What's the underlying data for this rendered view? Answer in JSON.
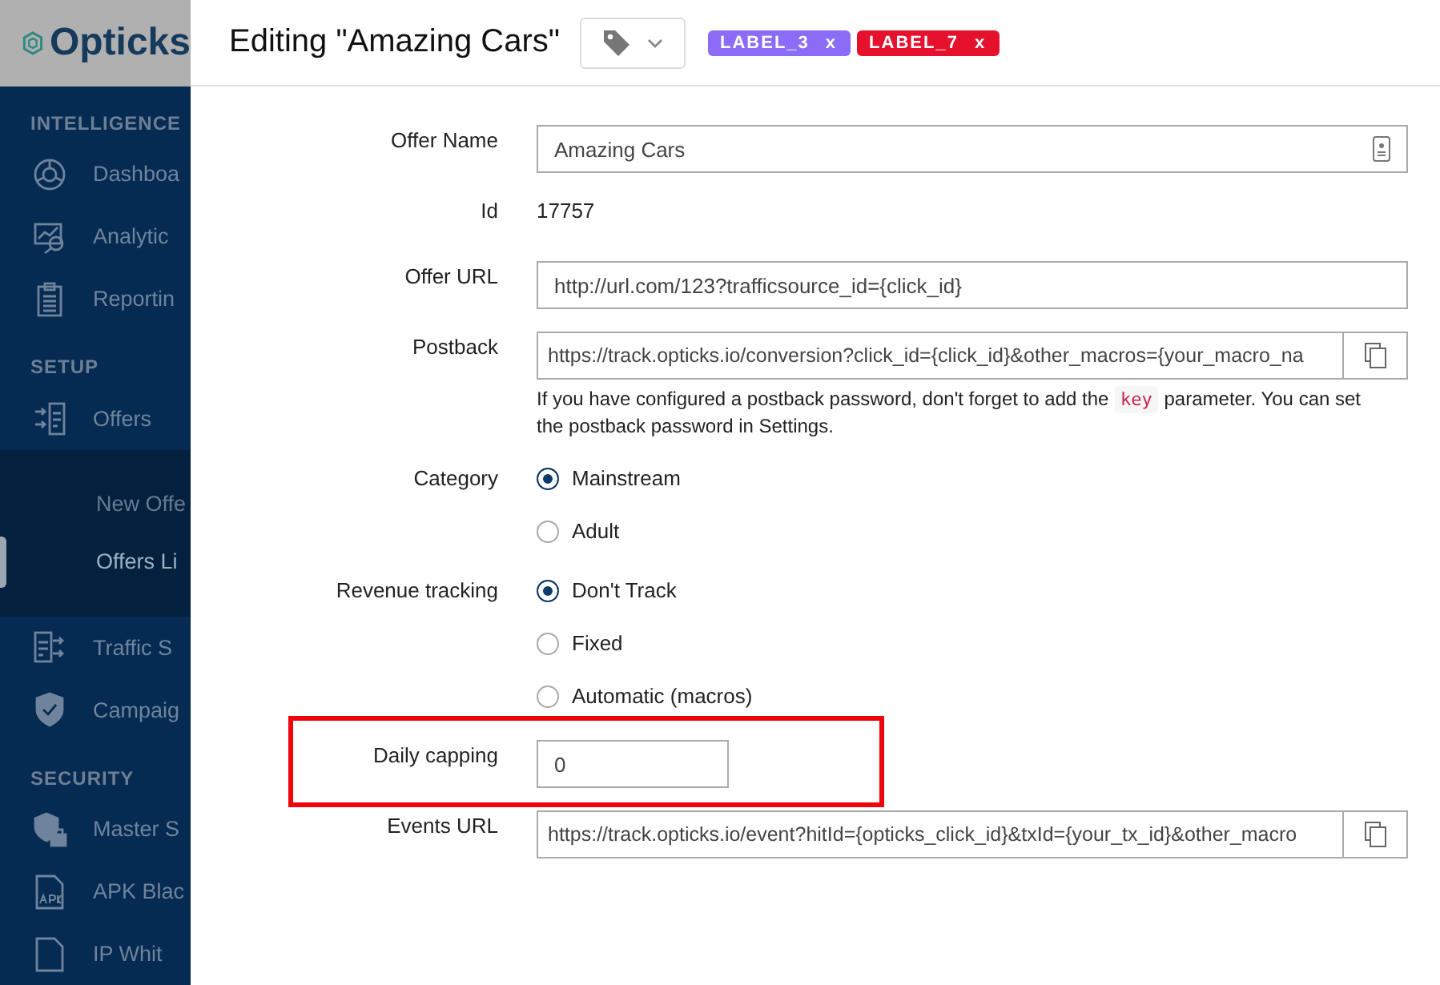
{
  "sidebar": {
    "logo": "Opticks",
    "sections": [
      {
        "heading": "INTELLIGENCE",
        "items": [
          {
            "label": "Dashboa",
            "expanded": false
          },
          {
            "label": "Analytic",
            "expanded": false
          },
          {
            "label": "Reportin",
            "expanded": false
          }
        ]
      },
      {
        "heading": "SETUP",
        "items": [
          {
            "label": "Offers",
            "expanded": true,
            "children": [
              {
                "label": "New Offe",
                "selected": false
              },
              {
                "label": "Offers Li",
                "selected": true
              }
            ]
          },
          {
            "label": "Traffic S",
            "expanded": false
          },
          {
            "label": "Campaig",
            "expanded": false
          }
        ]
      },
      {
        "heading": "SECURITY",
        "items": [
          {
            "label": "Master S",
            "expanded": false
          },
          {
            "label": "APK Blac",
            "expanded": false
          },
          {
            "label": "IP Whit",
            "expanded": false
          }
        ]
      }
    ]
  },
  "panel": {
    "title": "Editing \"Amazing Cars\"",
    "labels": [
      {
        "text": "LABEL_3",
        "color": "#8b6cf6",
        "remove": "x"
      },
      {
        "text": "LABEL_7",
        "color": "#e5112d",
        "remove": "x"
      }
    ],
    "fields": [
      {
        "kind": "text_field",
        "label": "Offer Name",
        "value": "Amazing Cars",
        "highlighted": false
      },
      {
        "kind": "static",
        "label": "Id",
        "value": "17757",
        "highlighted": false
      },
      {
        "kind": "text_field_plain",
        "label": "Offer URL",
        "value": "http://url.com/123?trafficsource_id={click_id}",
        "highlighted": false
      },
      {
        "kind": "copy_field",
        "label": "Postback",
        "value": "https://track.opticks.io/conversion?click_id={click_id}&other_macros={your_macro_na",
        "highlighted": false,
        "help": {
          "before": "If you have configured a postback password, don't forget to add the",
          "code": "key",
          "after": "parameter. You can set the postback password in Settings."
        }
      },
      {
        "kind": "radio_group",
        "label": "Category",
        "highlighted": false,
        "options": [
          {
            "label": "Mainstream",
            "selected": true
          },
          {
            "label": "Adult",
            "selected": false
          }
        ]
      },
      {
        "kind": "radio_group",
        "label": "Revenue tracking",
        "highlighted": false,
        "options": [
          {
            "label": "Don't Track",
            "selected": true
          },
          {
            "label": "Fixed",
            "selected": false
          },
          {
            "label": "Automatic (macros)",
            "selected": false
          }
        ]
      },
      {
        "kind": "number_field",
        "label": "Daily capping",
        "value": "0",
        "highlighted": true
      },
      {
        "kind": "copy_field",
        "label": "Events URL",
        "value": "https://track.opticks.io/event?hitId={opticks_click_id}&txId={your_tx_id}&other_macro",
        "highlighted": false
      }
    ]
  }
}
